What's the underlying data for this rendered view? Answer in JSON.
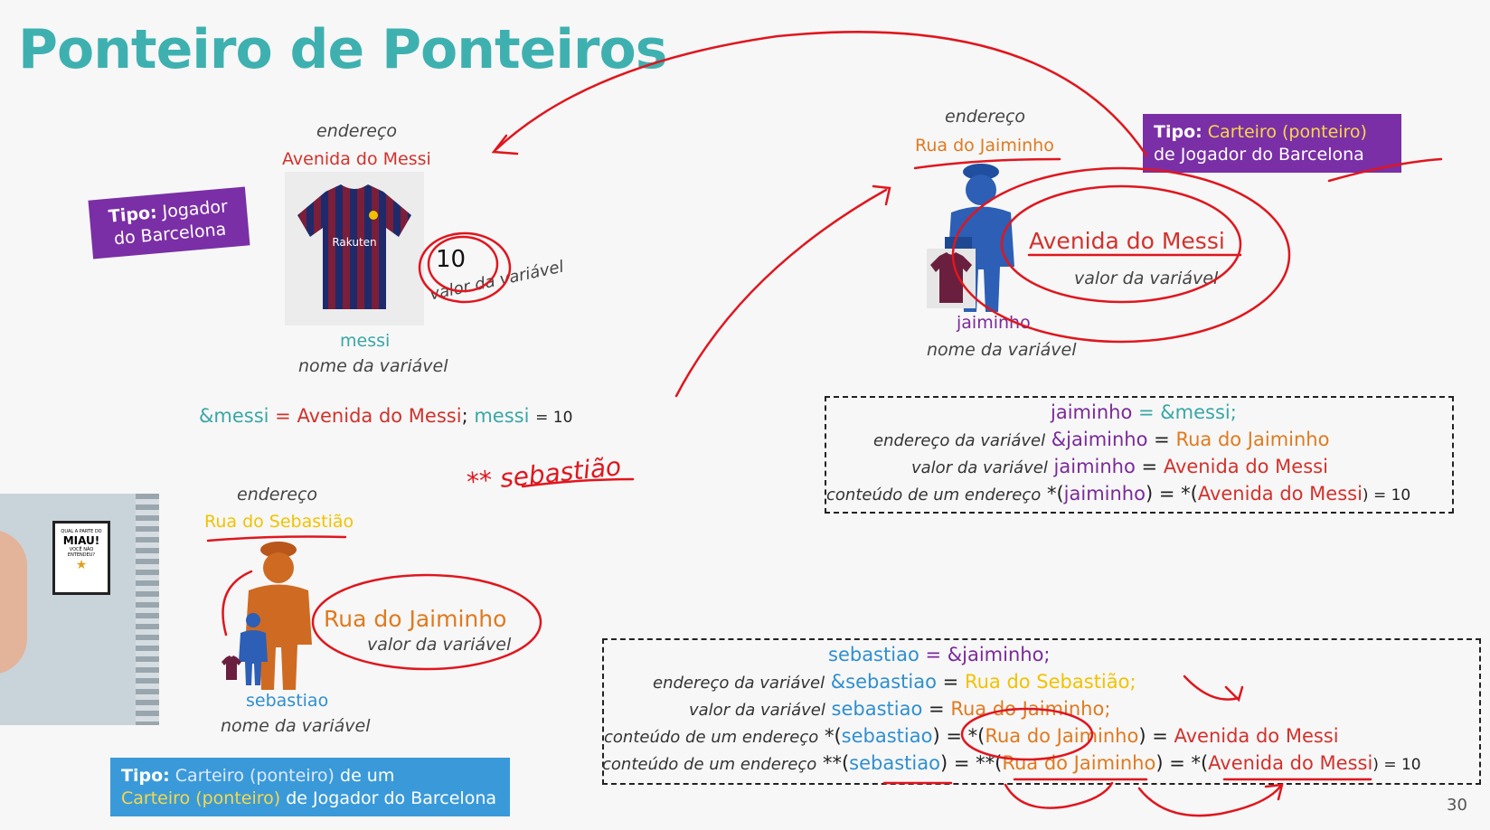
{
  "title": "Ponteiro de Ponteiros",
  "page_number": "30",
  "messi_block": {
    "type_label_prefix": "Tipo:",
    "type_label_text": "Jogador do Barcelona",
    "address_caption": "endereço",
    "address_value": "Avenida do Messi",
    "value_number": "10",
    "value_caption": "valor da variável",
    "var_name": "messi",
    "var_caption": "nome da variável",
    "expr_addr": "&messi",
    "expr_eq": "=",
    "expr_addr_value": "Avenida do Messi",
    "expr_sep": ";",
    "expr_var": "messi",
    "expr_var_value": "= 10"
  },
  "jaiminho_block": {
    "type_label_prefix": "Tipo:",
    "type_label_highlight": "Carteiro (ponteiro)",
    "type_label_rest": "de Jogador do Barcelona",
    "address_caption": "endereço",
    "address_value": "Rua do Jaiminho",
    "value_text": "Avenida do Messi",
    "value_caption": "valor da variável",
    "var_name": "jaiminho",
    "var_caption": "nome da variável",
    "code": {
      "l1_var": "jaiminho",
      "l1_rest": "= &messi;",
      "l2_caption": "endereço da variável",
      "l2_var": "&jaiminho",
      "l2_eq": "=",
      "l2_val": "Rua do Jaiminho",
      "l3_caption": "valor da variável",
      "l3_var": "jaiminho",
      "l3_eq": "=",
      "l3_val": "Avenida do Messi",
      "l4_caption": "conteúdo de um endereço",
      "l4_star": "*(",
      "l4_var": "jaiminho",
      "l4_mid": ") = *(",
      "l4_val": "Avenida do Messi",
      "l4_end": ") = 10"
    }
  },
  "sebastiao_block": {
    "type_label_prefix": "Tipo:",
    "type_label_highlight1": "Carteiro (ponteiro)",
    "type_label_mid": "de um",
    "type_label_highlight2": "Carteiro (ponteiro)",
    "type_label_rest": "de Jogador do Barcelona",
    "address_caption": "endereço",
    "address_value": "Rua do Sebastião",
    "value_text": "Rua do Jaiminho",
    "value_caption": "valor da variável",
    "var_name": "sebastiao",
    "var_caption": "nome da variável",
    "handwritten": "** sebastião",
    "code": {
      "l1_var": "sebastiao",
      "l1_rest": "= &jaiminho;",
      "l2_caption": "endereço da variável",
      "l2_var": "&sebastiao",
      "l2_eq": "=",
      "l2_val": "Rua do Sebastião;",
      "l3_caption": "valor da variável",
      "l3_var": "sebastiao",
      "l3_eq": "=",
      "l3_val": "Rua do Jaiminho;",
      "l4_caption": "conteúdo de um endereço",
      "l4_star": "*(",
      "l4_var": "sebastiao",
      "l4_mid": ") = *(",
      "l4_val": "Rua do Jaiminho",
      "l4_mid2": ") = ",
      "l4_val2": "Avenida do Messi",
      "l5_caption": "conteúdo de um endereço",
      "l5_star": "**(",
      "l5_var": "sebastiao",
      "l5_mid": ") = **(",
      "l5_val": "Rua do Jaiminho",
      "l5_mid2": ") = *(",
      "l5_val2": "Avenida do Messi",
      "l5_end": ") = 10"
    }
  },
  "webcam": {
    "poster_line1": "QUAL A PARTE DO",
    "poster_line2": "MIAU!",
    "poster_line3": "VOCÊ NÃO ENTENDEU?"
  },
  "colors": {
    "title": "#3fb0b0",
    "ink": "#e0161e",
    "purple_box": "#7a2fa6",
    "blue_box": "#3a9ad9"
  }
}
